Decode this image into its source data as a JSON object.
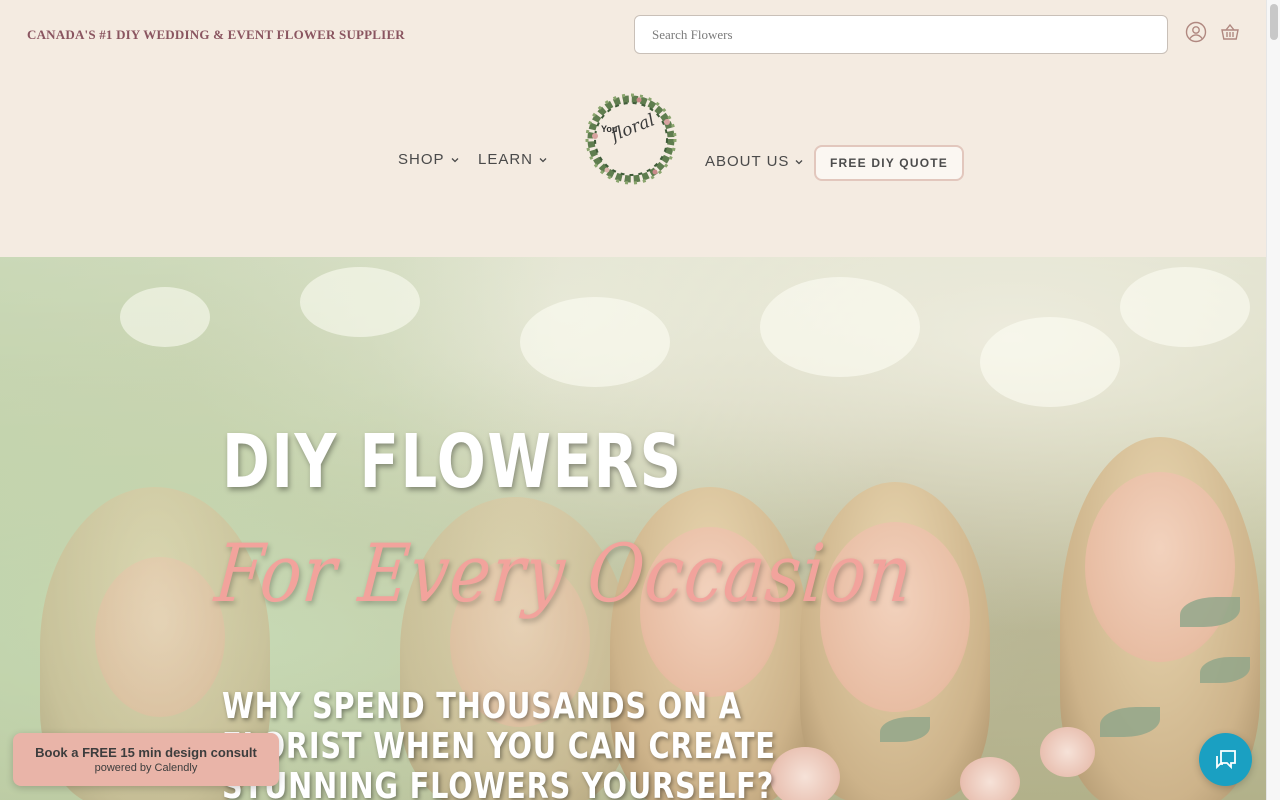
{
  "header": {
    "tagline": "CANADA'S #1 DIY WEDDING & EVENT FLOWER SUPPLIER",
    "search": {
      "placeholder": "Search Flowers",
      "value": ""
    },
    "icons": {
      "account": "account-icon",
      "cart": "basket-icon"
    }
  },
  "nav": {
    "shop": "SHOP",
    "learn": "LEARN",
    "about": "ABOUT US",
    "quote_button": "FREE DIY QUOTE"
  },
  "logo": {
    "you": "You",
    "floral": "floral"
  },
  "hero": {
    "title": "DIY FLOWERS",
    "script_title": "For Every Occasion",
    "subtitle": "WHY SPEND THOUSANDS ON A FLORIST WHEN YOU CAN CREATE STUNNING FLOWERS YOURSELF?"
  },
  "calendly": {
    "title": "Book a FREE 15 min design consult",
    "powered": "powered by Calendly"
  },
  "chat": {
    "icon": "chat-bubble-icon"
  },
  "colors": {
    "background": "#f4ebe1",
    "tagline": "#8a5560",
    "script_pink": "#f2a39c",
    "chat_blue": "#1aa0c2",
    "calendly_bg": "#e9b4a8"
  }
}
